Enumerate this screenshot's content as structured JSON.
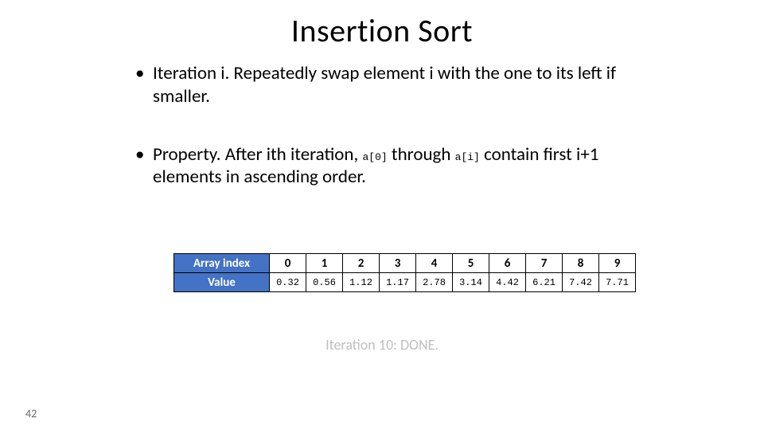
{
  "title": "Insertion Sort",
  "bullet1_a": "Iteration i.  Repeatedly swap element i with the one to its left if smaller.",
  "bullet2_a": "Property.  After ith iteration, ",
  "bullet2_code1": "a[0]",
  "bullet2_b": " through ",
  "bullet2_code2": "a[i]",
  "bullet2_c": " contain first i+1 elements in ascending order.",
  "table": {
    "row1_label": "Array index",
    "row2_label": "Value",
    "indices": [
      "0",
      "1",
      "2",
      "3",
      "4",
      "5",
      "6",
      "7",
      "8",
      "9"
    ],
    "values": [
      "0.32",
      "0.56",
      "1.12",
      "1.17",
      "2.78",
      "3.14",
      "4.42",
      "6.21",
      "7.42",
      "7.71"
    ]
  },
  "caption": "Iteration 10:  DONE.",
  "page": "42",
  "chart_data": {
    "type": "table",
    "title": "Insertion Sort array state after iteration 10",
    "columns": [
      "Array index",
      "Value"
    ],
    "indices": [
      0,
      1,
      2,
      3,
      4,
      5,
      6,
      7,
      8,
      9
    ],
    "values": [
      0.32,
      0.56,
      1.12,
      1.17,
      2.78,
      3.14,
      4.42,
      6.21,
      7.42,
      7.71
    ]
  }
}
